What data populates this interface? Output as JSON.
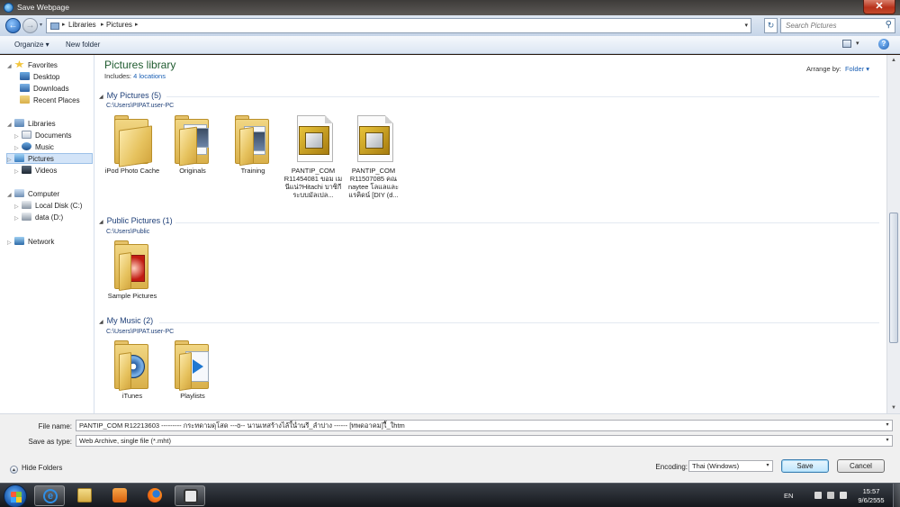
{
  "window": {
    "title": "Save Webpage",
    "close_glyph": "✕"
  },
  "address": {
    "crumbs": [
      "Libraries",
      "Pictures"
    ],
    "search_placeholder": "Search Pictures"
  },
  "toolbar": {
    "organize_label": "Organize ▾",
    "new_folder_label": "New folder"
  },
  "nav": {
    "favorites": {
      "label": "Favorites",
      "items": [
        "Desktop",
        "Downloads",
        "Recent Places"
      ]
    },
    "libraries": {
      "label": "Libraries",
      "items": [
        "Documents",
        "Music",
        "Pictures",
        "Videos"
      ],
      "selected": "Pictures"
    },
    "computer": {
      "label": "Computer",
      "items": [
        "Local Disk (C:)",
        "data (D:)"
      ]
    },
    "network": {
      "label": "Network"
    }
  },
  "library": {
    "title": "Pictures library",
    "includes_label": "Includes:",
    "includes_link": "4 locations",
    "arrange_label": "Arrange by:",
    "arrange_value": "Folder ▾"
  },
  "groups": [
    {
      "heading": "My Pictures (5)",
      "path": "C:\\Users\\PIPAT.user-PC",
      "items": [
        {
          "name": "iPod Photo Cache",
          "type": "folder"
        },
        {
          "name": "Originals",
          "type": "folder"
        },
        {
          "name": "Training",
          "type": "folder"
        },
        {
          "name": "PANTIP_COM R11454081 ขอม เมนีแน่?Hitachi บาซิกีระบบมัลเปล...",
          "type": "picture-file"
        },
        {
          "name": "PANTIP_COM R11507085 คณ naytee โลแลและ แรคิดน์ [DIY (d...",
          "type": "picture-file"
        }
      ]
    },
    {
      "heading": "Public Pictures (1)",
      "path": "C:\\Users\\Public",
      "items": [
        {
          "name": "Sample Pictures",
          "type": "folder"
        }
      ]
    },
    {
      "heading": "My Music (2)",
      "path": "C:\\Users\\PIPAT.user-PC",
      "items": [
        {
          "name": "iTunes",
          "type": "folder"
        },
        {
          "name": "Playlists",
          "type": "folder"
        }
      ]
    }
  ],
  "save": {
    "filename_label": "File name:",
    "filename_value": "PANTIP_COM  R12213603 --------- กระทดามดุโสด ---ö-- นานเทสร้างไล้ใ้น่ำนรี_ลำปาง ------ [ทพดอาคม]ใิ้_ใhtm",
    "type_label": "Save as type:",
    "type_value": "Web Archive, single file (*.mht)",
    "hide_folders_label": "Hide Folders",
    "encoding_label": "Encoding:",
    "encoding_value": "Thai (Windows)",
    "save_button": "Save",
    "cancel_button": "Cancel"
  },
  "taskbar": {
    "language": "EN",
    "time": "15:57",
    "date": "9/6/2555"
  }
}
